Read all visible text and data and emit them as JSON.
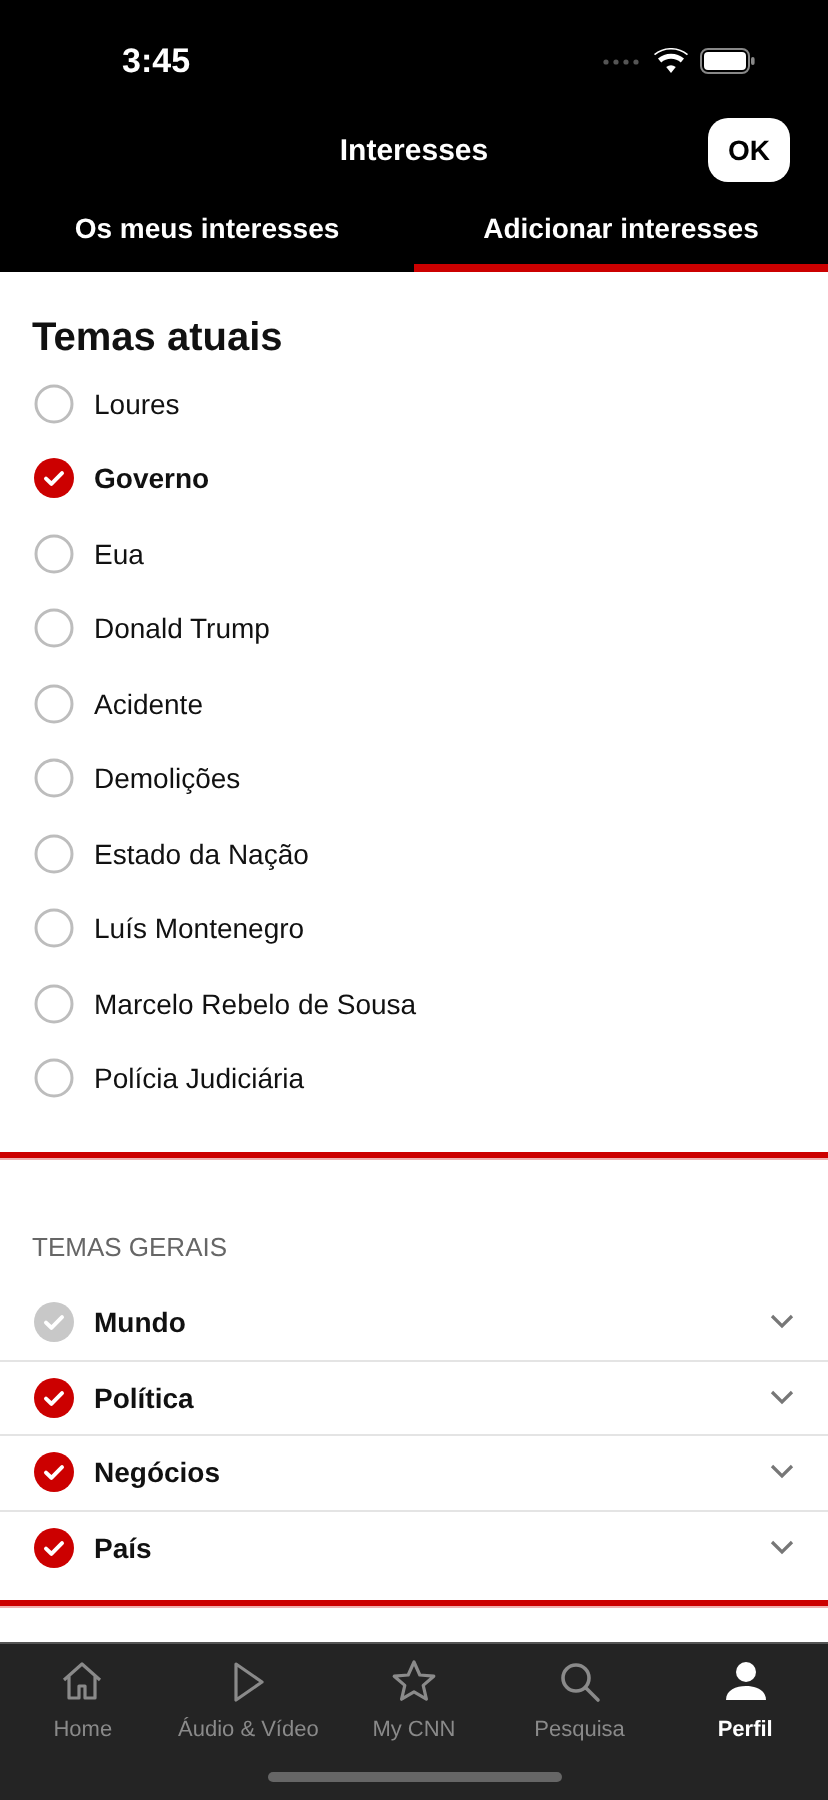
{
  "status_bar": {
    "time": "3:45"
  },
  "header": {
    "title": "Interesses",
    "action": "OK"
  },
  "tabs": [
    {
      "label": "Os meus interesses",
      "selected": false
    },
    {
      "label": "Adicionar interesses",
      "selected": true
    }
  ],
  "current_topics": {
    "title": "Temas atuais",
    "items": [
      {
        "label": "Loures",
        "checked": false
      },
      {
        "label": "Governo",
        "checked": true
      },
      {
        "label": "Eua",
        "checked": false
      },
      {
        "label": "Donald Trump",
        "checked": false
      },
      {
        "label": "Acidente",
        "checked": false
      },
      {
        "label": "Demolições",
        "checked": false
      },
      {
        "label": "Estado da Nação",
        "checked": false
      },
      {
        "label": "Luís Montenegro",
        "checked": false
      },
      {
        "label": "Marcelo Rebelo de Sousa",
        "checked": false
      },
      {
        "label": "Polícia Judiciária",
        "checked": false
      }
    ]
  },
  "general_topics": {
    "title": "TEMAS GERAIS",
    "items": [
      {
        "label": "Mundo",
        "checked": true,
        "disabled": true,
        "expanded": false
      },
      {
        "label": "Política",
        "checked": true,
        "disabled": false,
        "expanded": false
      },
      {
        "label": "Negócios",
        "checked": true,
        "disabled": false,
        "expanded": false
      },
      {
        "label": "País",
        "checked": true,
        "disabled": false,
        "expanded": false
      }
    ]
  },
  "tab_bar": [
    {
      "label": "Home",
      "kind": "home",
      "selected": false
    },
    {
      "label": "Áudio & Vídeo",
      "kind": "play",
      "selected": false
    },
    {
      "label": "My CNN",
      "kind": "star",
      "selected": false
    },
    {
      "label": "Pesquisa",
      "kind": "search",
      "selected": false
    },
    {
      "label": "Perfil",
      "kind": "person",
      "selected": true
    }
  ]
}
